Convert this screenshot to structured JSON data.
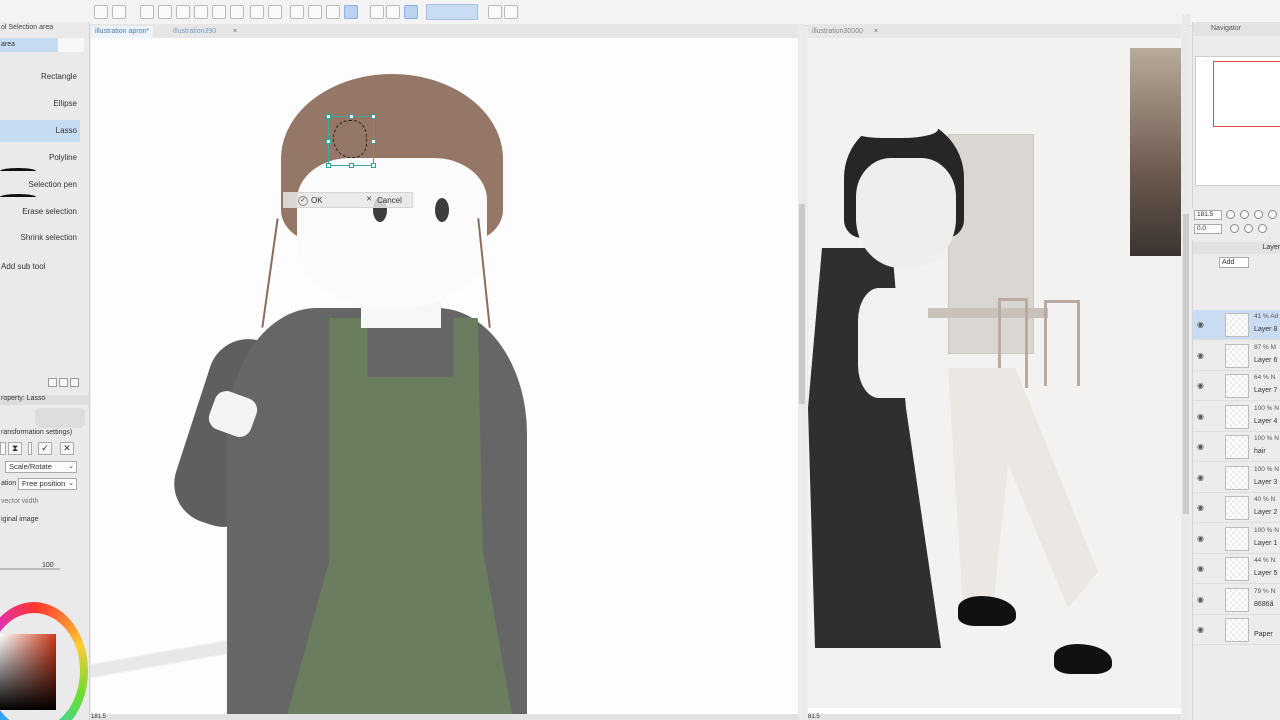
{
  "left_panel": {
    "header": "ol Selection area",
    "tab": "area",
    "tools": [
      "Rectangle",
      "Ellipse",
      "Lasso",
      "Polyline",
      "Selection pen",
      "Erase selection",
      "Shrink selection"
    ],
    "active_tool": "Lasso",
    "add_sub_tool": "Add sub tool",
    "property_header": "roperty: Lasso",
    "transformation_settings": "ransformation settings)",
    "scale_rotate": "Scale/Rotate",
    "ation_label": "ation",
    "free_position": "Free position",
    "vector_width": "vector width",
    "original_image": "iginal image",
    "slider_value": "100"
  },
  "canvas1": {
    "tab_active": "illustration apron*",
    "tab_inactive": "illustration390",
    "selection_bar": {
      "ok": "OK",
      "cancel": "Cancel"
    },
    "status": "181.5"
  },
  "canvas2": {
    "tab": "illustration30000",
    "status": "81.5"
  },
  "navigator": {
    "title": "Navigator",
    "zoom": "181.5",
    "angle": "0.0"
  },
  "layers": {
    "title": "Layer",
    "blend_mode": "Add",
    "rows": [
      {
        "pct": "41 % Ad",
        "name": "Layer 8",
        "active": true
      },
      {
        "pct": "87 % M",
        "name": "Layer 6"
      },
      {
        "pct": "64 % N",
        "name": "Layer 7"
      },
      {
        "pct": "100 % N",
        "name": "Layer 4"
      },
      {
        "pct": "100 % N",
        "name": "hair"
      },
      {
        "pct": "100 % N",
        "name": "Layer 3"
      },
      {
        "pct": "40 % N",
        "name": "Layer 2"
      },
      {
        "pct": "100 % N",
        "name": "Layer 1"
      },
      {
        "pct": "44 % N",
        "name": "Layer 5"
      },
      {
        "pct": "79 % N",
        "name": "8686ã"
      },
      {
        "pct": "",
        "name": "Paper"
      }
    ]
  },
  "colors": {
    "accent": "#c5dcf3",
    "apron": "#6b7d5f",
    "selection": "#3aa9a0"
  }
}
